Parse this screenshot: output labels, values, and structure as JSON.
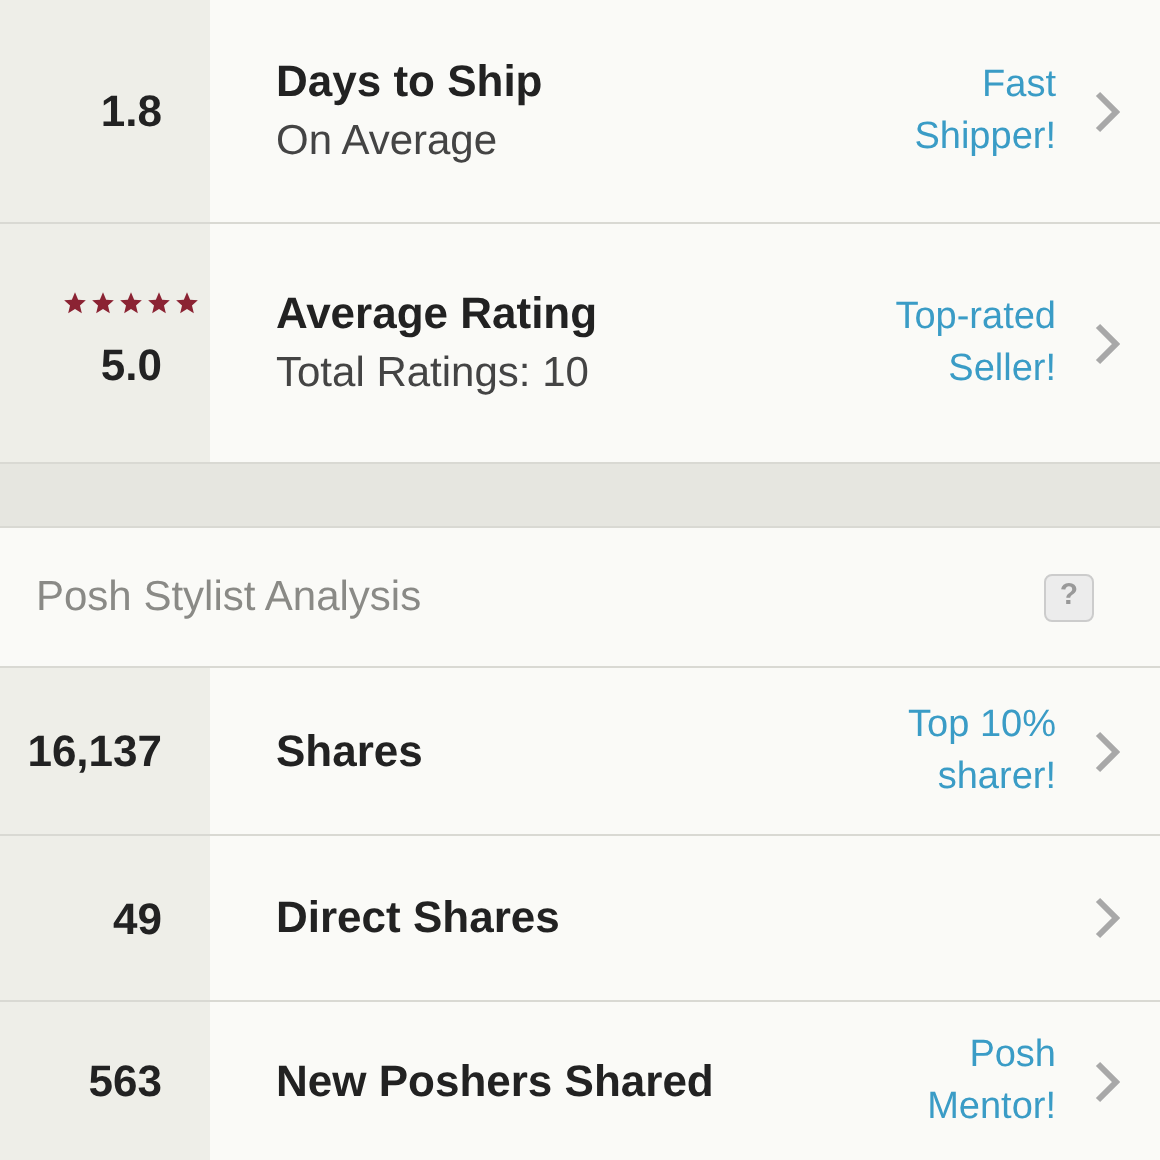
{
  "top_stats": [
    {
      "value": "1.8",
      "title": "Days to Ship",
      "subtitle": "On Average",
      "badge": "Fast\nShipper!"
    },
    {
      "value": "5.0",
      "stars": 5,
      "title": "Average Rating",
      "subtitle": "Total Ratings: 10",
      "badge": "Top-rated\nSeller!"
    }
  ],
  "section": {
    "title": "Posh Stylist Analysis",
    "help": "?"
  },
  "stylist_stats": [
    {
      "value": "16,137",
      "title": "Shares",
      "badge": "Top 10%\nsharer!"
    },
    {
      "value": "49",
      "title": "Direct Shares"
    },
    {
      "value": "563",
      "title": "New Poshers Shared",
      "badge": "Posh\nMentor!"
    }
  ]
}
